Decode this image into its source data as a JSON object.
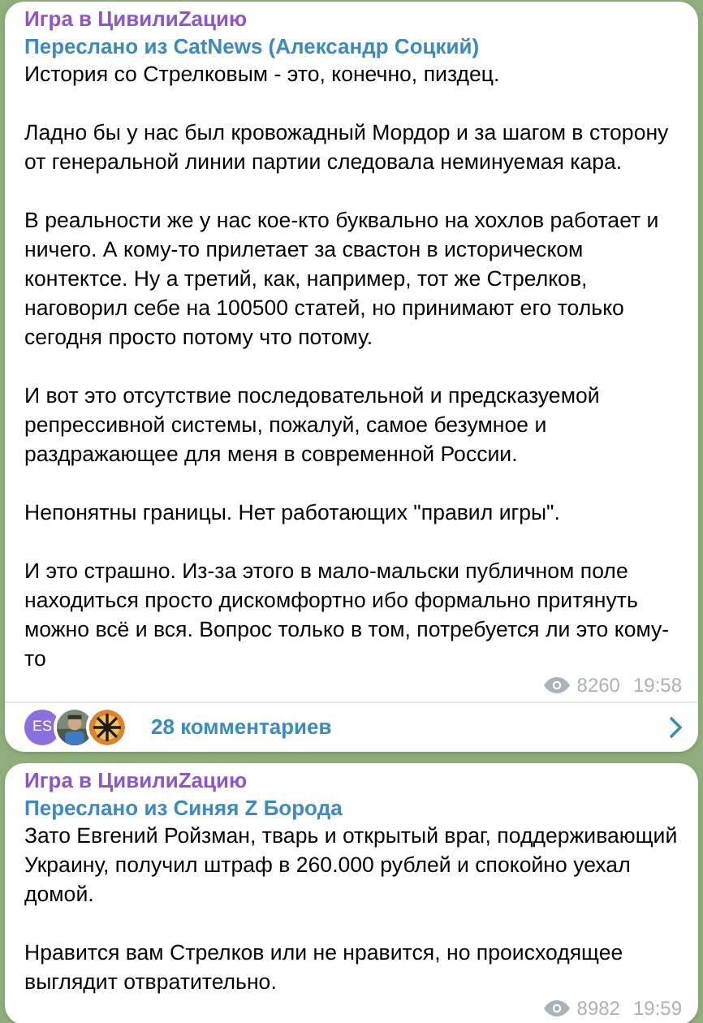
{
  "messages": [
    {
      "channel": "Игра в ЦивилиZацию",
      "forwarded_from": "Переслано из CatNews (Александр Соцкий)",
      "paragraphs": [
        "История со Стрелковым - это, конечно, пиздец.",
        "Ладно бы у нас был кровожадный Мордор и за шагом в сторону от генеральной линии партии следовала неминуемая кара.",
        "В реальности же у нас кое-кто буквально на хохлов работает и ничего. А кому-то прилетает за свастон в историческом контектсе. Ну а третий, как, например, тот же Стрелков, наговорил себе на 100500 статей, но принимают его только сегодня просто потому что потому.",
        "И вот это отсутствие последовательной и предсказуемой репрессивной системы, пожалуй, самое безумное и раздражающее для меня в современной России.",
        "Непонятны границы. Нет работающих \"правил игры\".",
        "И это страшно. Из-за этого в мало-мальски публичном поле находиться просто дискомфортно ибо формально притянуть можно всё и вся. Вопрос только в том, потребуется ли это кому-то"
      ],
      "views": "8260",
      "time": "19:58",
      "comments": {
        "avatars": [
          {
            "kind": "initials",
            "text": "ES"
          },
          {
            "kind": "picture"
          },
          {
            "kind": "emblem"
          }
        ],
        "label": "28 комментариев"
      }
    },
    {
      "channel": "Игра в ЦивилиZацию",
      "forwarded_from": "Переслано из Синяя Z Борода",
      "paragraphs": [
        "Зато Евгений Ройзман, тварь и открытый враг, поддерживающий Украину, получил штраф в 260.000 рублей и спокойно уехал домой.",
        "Нравится вам Стрелков или не нравится, но происходящее выглядит отвратительно."
      ],
      "views": "8982",
      "time": "19:59"
    }
  ]
}
